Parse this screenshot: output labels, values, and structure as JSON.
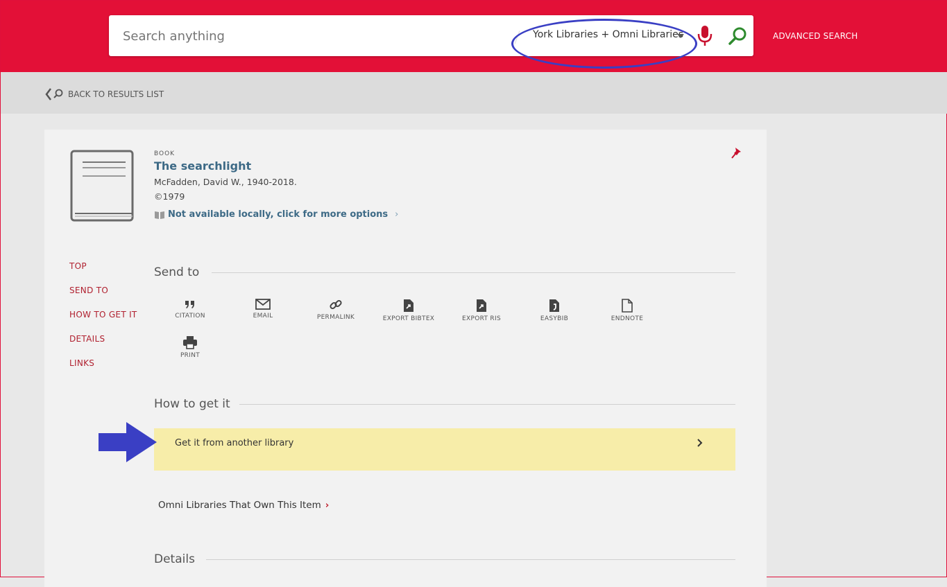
{
  "header": {
    "search_placeholder": "Search anything",
    "scope": "York Libraries + Omni Libraries",
    "advanced_search": "ADVANCED SEARCH",
    "brand_color": "#e31037"
  },
  "backbar": {
    "back_label": "BACK TO RESULTS LIST"
  },
  "record": {
    "type": "BOOK",
    "title": "The searchlight",
    "author": "McFadden, David W., 1940-2018.",
    "date": "©1979",
    "availability": "Not available locally, click for more options"
  },
  "sidenav": {
    "items": [
      {
        "label": "TOP"
      },
      {
        "label": "SEND TO"
      },
      {
        "label": "HOW TO GET IT"
      },
      {
        "label": "DETAILS"
      },
      {
        "label": "LINKS"
      }
    ]
  },
  "send_to": {
    "heading": "Send to",
    "actions": [
      {
        "label": "CITATION",
        "icon": "quote-icon"
      },
      {
        "label": "EMAIL",
        "icon": "email-icon"
      },
      {
        "label": "PERMALINK",
        "icon": "link-icon"
      },
      {
        "label": "EXPORT BIBTEX",
        "icon": "export-file-icon"
      },
      {
        "label": "EXPORT RIS",
        "icon": "export-file-icon"
      },
      {
        "label": "EASYBIB",
        "icon": "easybib-icon"
      },
      {
        "label": "ENDNOTE",
        "icon": "document-icon"
      },
      {
        "label": "PRINT",
        "icon": "printer-icon"
      }
    ]
  },
  "how_to_get": {
    "heading": "How to get it",
    "option": "Get it from another library",
    "omni_link": "Omni Libraries That Own This Item"
  },
  "details": {
    "heading": "Details"
  }
}
